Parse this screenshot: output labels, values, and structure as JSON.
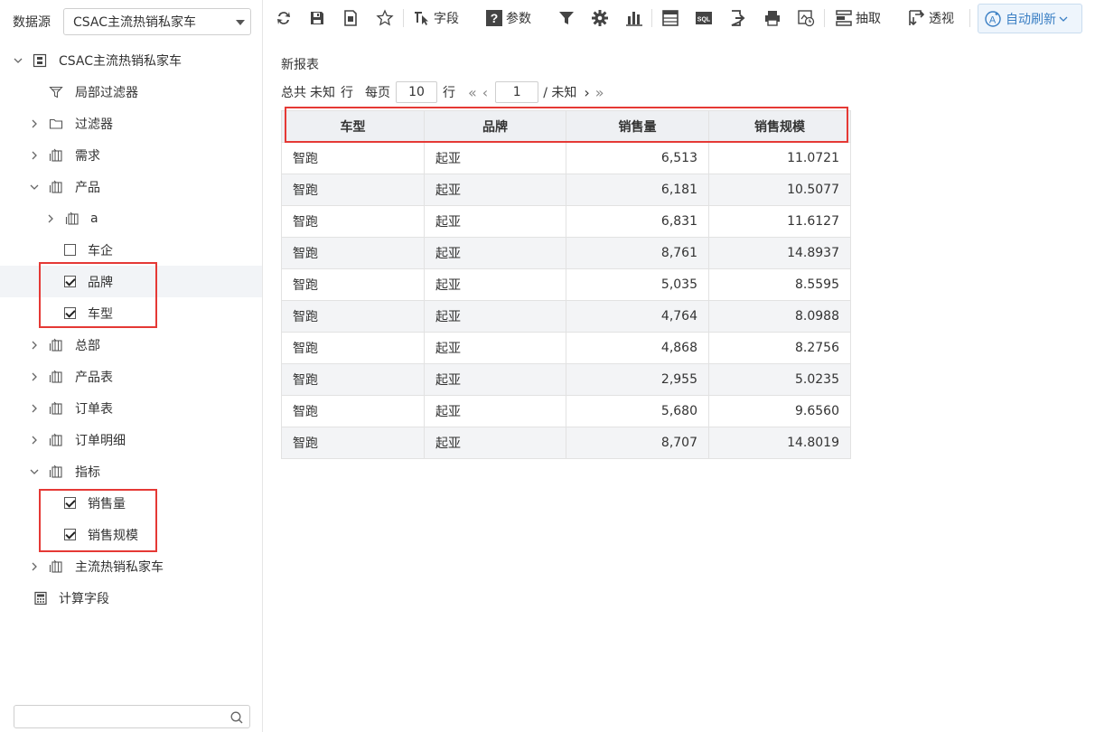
{
  "datasource": {
    "label": "数据源",
    "value": "CSAC主流热销私家车"
  },
  "tree": {
    "root": "CSAC主流热销私家车",
    "local_filter": "局部过滤器",
    "filter": "过滤器",
    "demand": "需求",
    "product": "产品",
    "a": "a",
    "car_company": "车企",
    "brand": "品牌",
    "model": "车型",
    "hq": "总部",
    "product_table": "产品表",
    "order_table": "订单表",
    "order_detail": "订单明细",
    "metrics": "指标",
    "sales_volume": "销售量",
    "sales_scale": "销售规模",
    "main_cars": "主流热销私家车",
    "calc_field": "计算字段"
  },
  "toolbar": {
    "field": "字段",
    "param": "参数",
    "extract": "抽取",
    "pivot": "透视",
    "auto_refresh": "自动刷新",
    "sql": "SQL"
  },
  "report": {
    "title": "新报表",
    "pager": {
      "total": "总共",
      "unknown": "未知",
      "row": "行",
      "per_page": "每页",
      "page_size": "10",
      "row2": "行",
      "page": "1",
      "of_unknown": "/ 未知"
    },
    "columns": [
      "车型",
      "品牌",
      "销售量",
      "销售规模"
    ],
    "rows": [
      [
        "智跑",
        "起亚",
        "6,513",
        "11.0721"
      ],
      [
        "智跑",
        "起亚",
        "6,181",
        "10.5077"
      ],
      [
        "智跑",
        "起亚",
        "6,831",
        "11.6127"
      ],
      [
        "智跑",
        "起亚",
        "8,761",
        "14.8937"
      ],
      [
        "智跑",
        "起亚",
        "5,035",
        "8.5595"
      ],
      [
        "智跑",
        "起亚",
        "4,764",
        "8.0988"
      ],
      [
        "智跑",
        "起亚",
        "4,868",
        "8.2756"
      ],
      [
        "智跑",
        "起亚",
        "2,955",
        "5.0235"
      ],
      [
        "智跑",
        "起亚",
        "5,680",
        "9.6560"
      ],
      [
        "智跑",
        "起亚",
        "8,707",
        "14.8019"
      ]
    ]
  }
}
